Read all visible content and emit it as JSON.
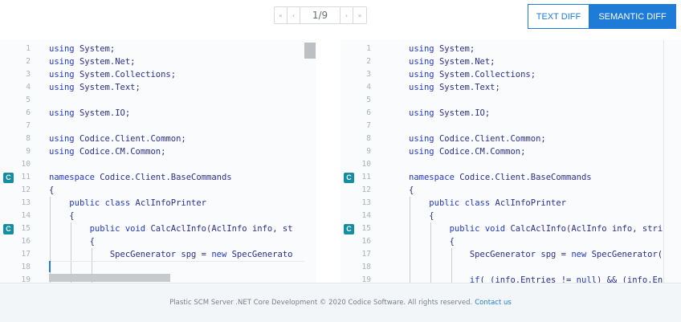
{
  "pager": {
    "first_label": "«",
    "prev_label": "‹",
    "counter": "1/9",
    "next_label": "›",
    "last_label": "»"
  },
  "mode": {
    "text_diff_label": "TEXT DIFF",
    "semantic_diff_label": "SEMANTIC DIFF",
    "active": "semantic"
  },
  "colors": {
    "accent": "#1e7bd8",
    "badge": "#138ea3"
  },
  "left_pane": {
    "lines": [
      {
        "n": "1",
        "text": "using System;"
      },
      {
        "n": "2",
        "text": "using System.Net;"
      },
      {
        "n": "3",
        "text": "using System.Collections;"
      },
      {
        "n": "4",
        "text": "using System.Text;"
      },
      {
        "n": "5",
        "text": ""
      },
      {
        "n": "6",
        "text": "using System.IO;"
      },
      {
        "n": "7",
        "text": ""
      },
      {
        "n": "8",
        "text": "using Codice.Client.Common;"
      },
      {
        "n": "9",
        "text": "using Codice.CM.Common;"
      },
      {
        "n": "10",
        "text": ""
      },
      {
        "n": "11",
        "text": "namespace Codice.Client.BaseCommands",
        "badge": "C"
      },
      {
        "n": "12",
        "text": "{"
      },
      {
        "n": "13",
        "text": "    public class AclInfoPrinter"
      },
      {
        "n": "14",
        "text": "    {"
      },
      {
        "n": "15",
        "text": "        public void CalcAclInfo(AclInfo info, st",
        "badge": "C"
      },
      {
        "n": "16",
        "text": "        {"
      },
      {
        "n": "17",
        "text": "            SpecGenerator spg = new SpecGenerato"
      },
      {
        "n": "18",
        "text": ""
      },
      {
        "n": "19",
        "text": ""
      }
    ]
  },
  "right_pane": {
    "lines": [
      {
        "n": "1",
        "text": "using System;"
      },
      {
        "n": "2",
        "text": "using System.Net;"
      },
      {
        "n": "3",
        "text": "using System.Collections;"
      },
      {
        "n": "4",
        "text": "using System.Text;"
      },
      {
        "n": "5",
        "text": ""
      },
      {
        "n": "6",
        "text": "using System.IO;"
      },
      {
        "n": "7",
        "text": ""
      },
      {
        "n": "8",
        "text": "using Codice.Client.Common;"
      },
      {
        "n": "9",
        "text": "using Codice.CM.Common;"
      },
      {
        "n": "10",
        "text": ""
      },
      {
        "n": "11",
        "text": "namespace Codice.Client.BaseCommands",
        "badge": "C"
      },
      {
        "n": "12",
        "text": "{"
      },
      {
        "n": "13",
        "text": "    public class AclInfoPrinter"
      },
      {
        "n": "14",
        "text": "    {"
      },
      {
        "n": "15",
        "text": "        public void CalcAclInfo(AclInfo info, stri",
        "badge": "C"
      },
      {
        "n": "16",
        "text": "        {"
      },
      {
        "n": "17",
        "text": "            SpecGenerator spg = new SpecGenerator("
      },
      {
        "n": "18",
        "text": ""
      },
      {
        "n": "19",
        "text": "            if( (info.Entries != null) && (info.En"
      }
    ]
  },
  "footer": {
    "text": "Plastic SCM Server .NET Core Development © 2020 Codice Software. All rights reserved.",
    "link": "Contact us"
  }
}
